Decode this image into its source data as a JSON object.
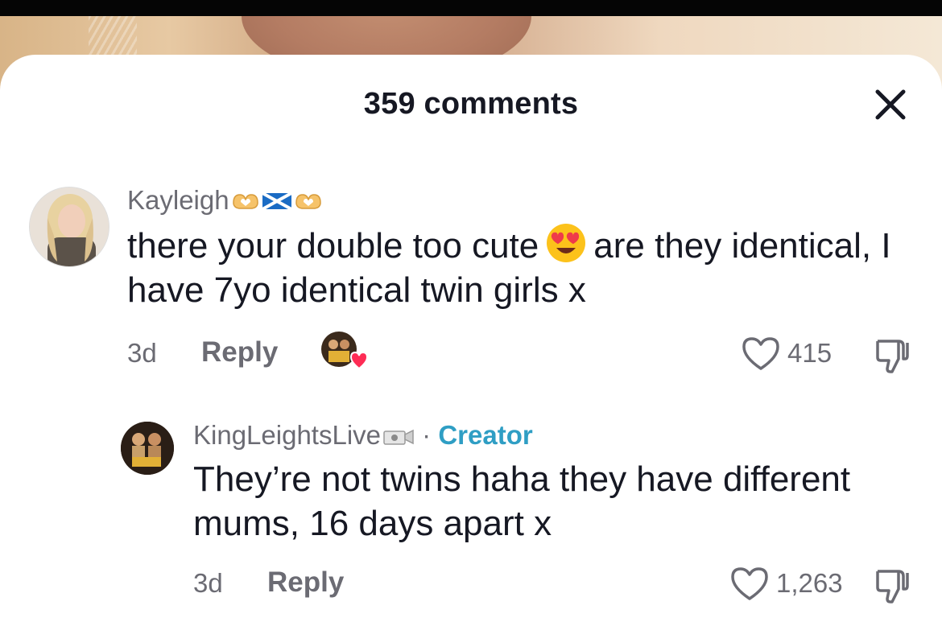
{
  "header": {
    "title": "359 comments",
    "close_icon": "close-icon"
  },
  "comments": [
    {
      "username": "Kayleigh",
      "username_emojis": [
        "heart-hands",
        "scotland-flag",
        "heart-hands"
      ],
      "text_before_emoji": "there your double too cute",
      "inline_emoji": "heart-eyes-emoji",
      "text_after_emoji": "are they identical, I have 7yo identical twin girls x",
      "time": "3d",
      "reply_label": "Reply",
      "creator_liked": true,
      "likes": "415"
    },
    {
      "username": "KingLeightsLive",
      "username_emojis": [
        "camera-emoji"
      ],
      "separator": "·",
      "creator_label": "Creator",
      "text": "They’re not twins haha they have different mums, 16 days apart x",
      "time": "3d",
      "reply_label": "Reply",
      "likes": "1,263"
    }
  ],
  "colors": {
    "text_primary": "#161823",
    "text_secondary": "#6b6b73",
    "creator_accent": "#2f9ec4",
    "like_heart": "#fe2c55"
  }
}
